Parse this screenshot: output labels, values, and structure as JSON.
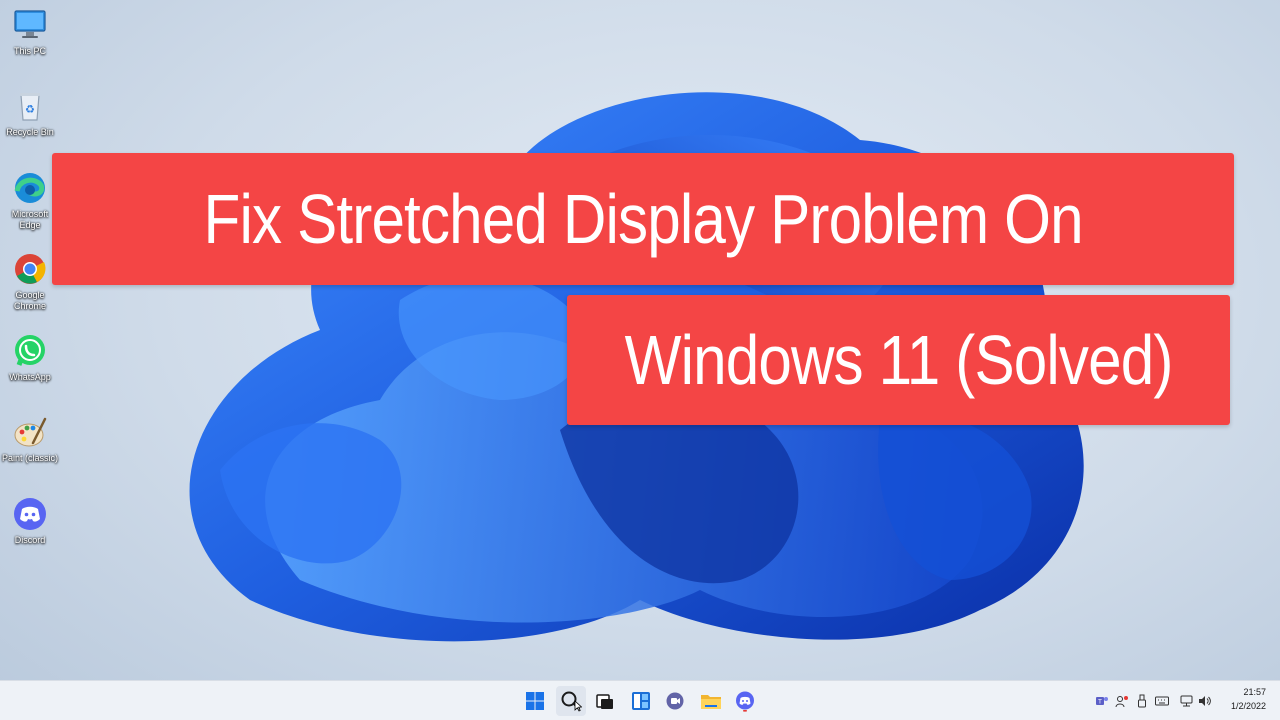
{
  "desktop_icons": [
    {
      "label": "This PC",
      "icon": "monitor-icon"
    },
    {
      "label": "Recycle Bin",
      "icon": "recycle-bin-icon"
    },
    {
      "label": "Microsoft\nEdge",
      "icon": "edge-icon"
    },
    {
      "label": "Google\nChrome",
      "icon": "chrome-icon"
    },
    {
      "label": "WhatsApp",
      "icon": "whatsapp-icon"
    },
    {
      "label": "Paint (classic)",
      "icon": "paint-icon"
    },
    {
      "label": "Discord",
      "icon": "discord-icon"
    }
  ],
  "banner": {
    "line1": "Fix Stretched Display Problem On",
    "line2": "Windows 11 (Solved)",
    "color": "#f44545"
  },
  "taskbar": {
    "apps": [
      "start-icon",
      "search-icon",
      "task-view-icon",
      "widgets-icon",
      "teams-chat-icon",
      "file-explorer-icon",
      "discord-icon"
    ],
    "tray": [
      "teams-tray-icon",
      "people-tray-icon",
      "usb-tray-icon",
      "keyboard-tray-icon",
      "network-icon",
      "volume-icon"
    ],
    "clock": {
      "time": "21:57",
      "date": "1/2/2022"
    }
  },
  "colors": {
    "accent_blue": "#1f5fe0",
    "banner_red": "#f44545"
  }
}
